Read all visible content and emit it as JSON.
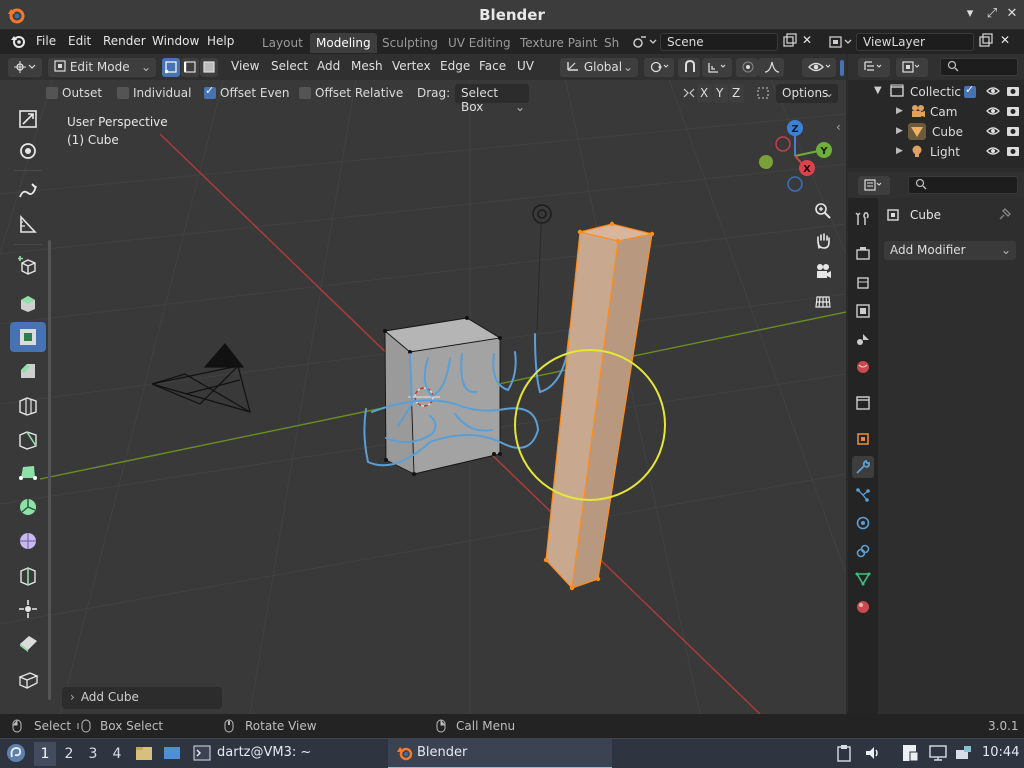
{
  "window": {
    "title": "Blender"
  },
  "menubar": {
    "items": [
      "File",
      "Edit",
      "Render",
      "Window",
      "Help"
    ],
    "workspaces": [
      "Layout",
      "Modeling",
      "Sculpting",
      "UV Editing",
      "Texture Paint",
      "Sh"
    ],
    "active_workspace": "Modeling",
    "scene": "Scene",
    "view_layer": "ViewLayer"
  },
  "viewport_header": {
    "mode": "Edit Mode",
    "menus": [
      "View",
      "Select",
      "Add",
      "Mesh",
      "Vertex",
      "Edge",
      "Face",
      "UV"
    ],
    "orientation": "Global",
    "axes": [
      "X",
      "Y",
      "Z"
    ],
    "options": "Options"
  },
  "tool_settings": {
    "outset": {
      "label": "Outset",
      "checked": false
    },
    "individual": {
      "label": "Individual",
      "checked": false
    },
    "offset_even": {
      "label": "Offset Even",
      "checked": true
    },
    "offset_relative": {
      "label": "Offset Relative",
      "checked": false
    },
    "drag_label": "Drag:",
    "drag_value": "Select Box"
  },
  "viewport": {
    "perspective": "User Perspective",
    "object_info": "(1) Cube",
    "gizmo_axes": [
      "Z",
      "Y",
      "X"
    ],
    "last_operator": "Add Cube"
  },
  "outliner": {
    "rows": [
      {
        "name": "Collectic",
        "icon": "collection-icon"
      },
      {
        "name": "Cam",
        "icon": "camera-icon"
      },
      {
        "name": "Cube",
        "icon": "mesh-icon"
      },
      {
        "name": "Light",
        "icon": "light-icon"
      }
    ]
  },
  "properties": {
    "object_name": "Cube",
    "add_modifier": "Add Modifier"
  },
  "statusbar": {
    "select": "Select",
    "box_select": "Box Select",
    "rotate_view": "Rotate View",
    "call_menu": "Call Menu",
    "version": "3.0.1"
  },
  "taskbar": {
    "desktops": [
      "1",
      "2",
      "3",
      "4"
    ],
    "terminal": "dartz@VM3: ~",
    "blender": "Blender",
    "clock": "10:44"
  },
  "colors": {
    "accent": "#4772b3",
    "x_axis": "#b43a3a",
    "y_axis": "#6b8e23",
    "selection": "#ff8c1a",
    "annotation": "#5a9fd6",
    "cursor_circle": "#e6e636"
  }
}
